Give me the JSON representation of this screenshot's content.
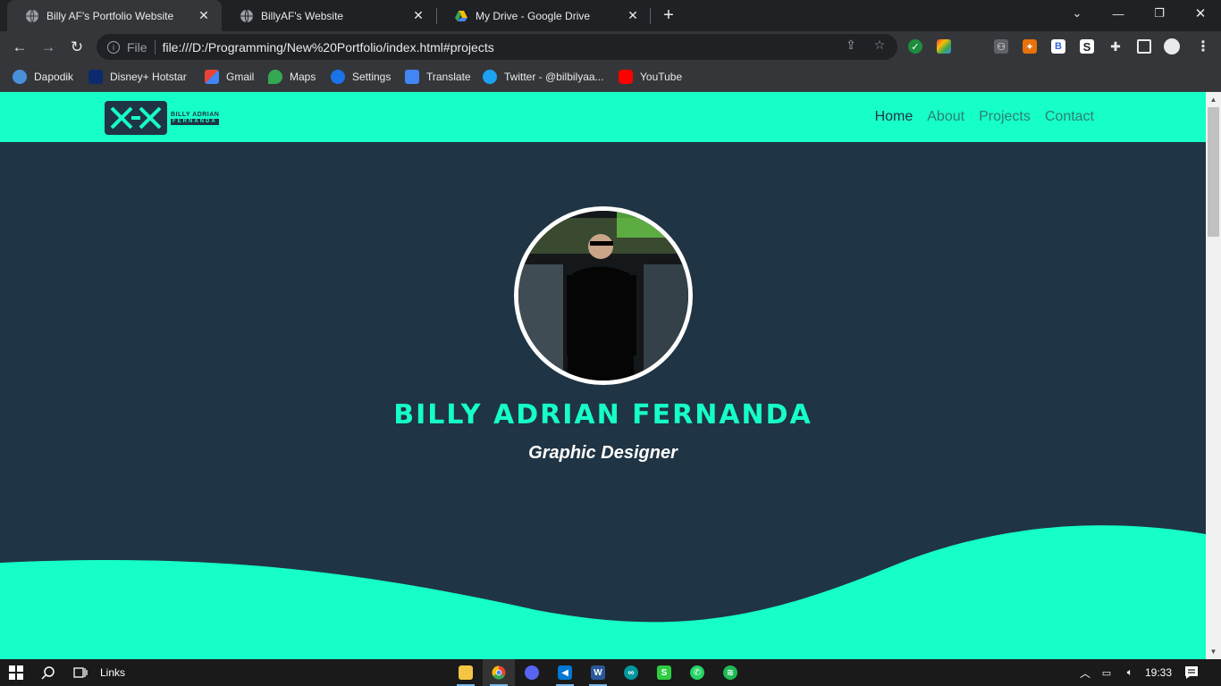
{
  "browser": {
    "tabs": [
      {
        "title": "Billy AF's Portfolio Website",
        "active": true
      },
      {
        "title": "BillyAF's Website",
        "active": false
      },
      {
        "title": "My Drive - Google Drive",
        "active": false
      }
    ],
    "omnibox": {
      "scheme": "File",
      "url": "file:///D:/Programming/New%20Portfolio/index.html#projects"
    },
    "bookmarks": [
      {
        "label": "Dapodik",
        "color": "#4a90d9"
      },
      {
        "label": "Disney+ Hotstar",
        "color": "#0d2a6e"
      },
      {
        "label": "Gmail",
        "color": "#ea4335"
      },
      {
        "label": "Maps",
        "color": "#34a853"
      },
      {
        "label": "Settings",
        "color": "#1a73e8"
      },
      {
        "label": "Translate",
        "color": "#4285f4"
      },
      {
        "label": "Twitter - @bilbilyaa...",
        "color": "#1da1f2"
      },
      {
        "label": "YouTube",
        "color": "#ff0000"
      }
    ]
  },
  "site": {
    "logo": {
      "line1": "BILLY ADRIAN",
      "line2": "FERNANDA"
    },
    "nav": [
      {
        "label": "Home",
        "active": true
      },
      {
        "label": "About",
        "active": false
      },
      {
        "label": "Projects",
        "active": false
      },
      {
        "label": "Contact",
        "active": false
      }
    ],
    "hero": {
      "name": "BILLY ADRIAN FERNANDA",
      "role": "Graphic Designer"
    },
    "colors": {
      "accent": "#16ffc8",
      "background": "#1f3444",
      "text": "#ffffff"
    }
  },
  "taskbar": {
    "search_label": "Links",
    "time": "19:33"
  }
}
